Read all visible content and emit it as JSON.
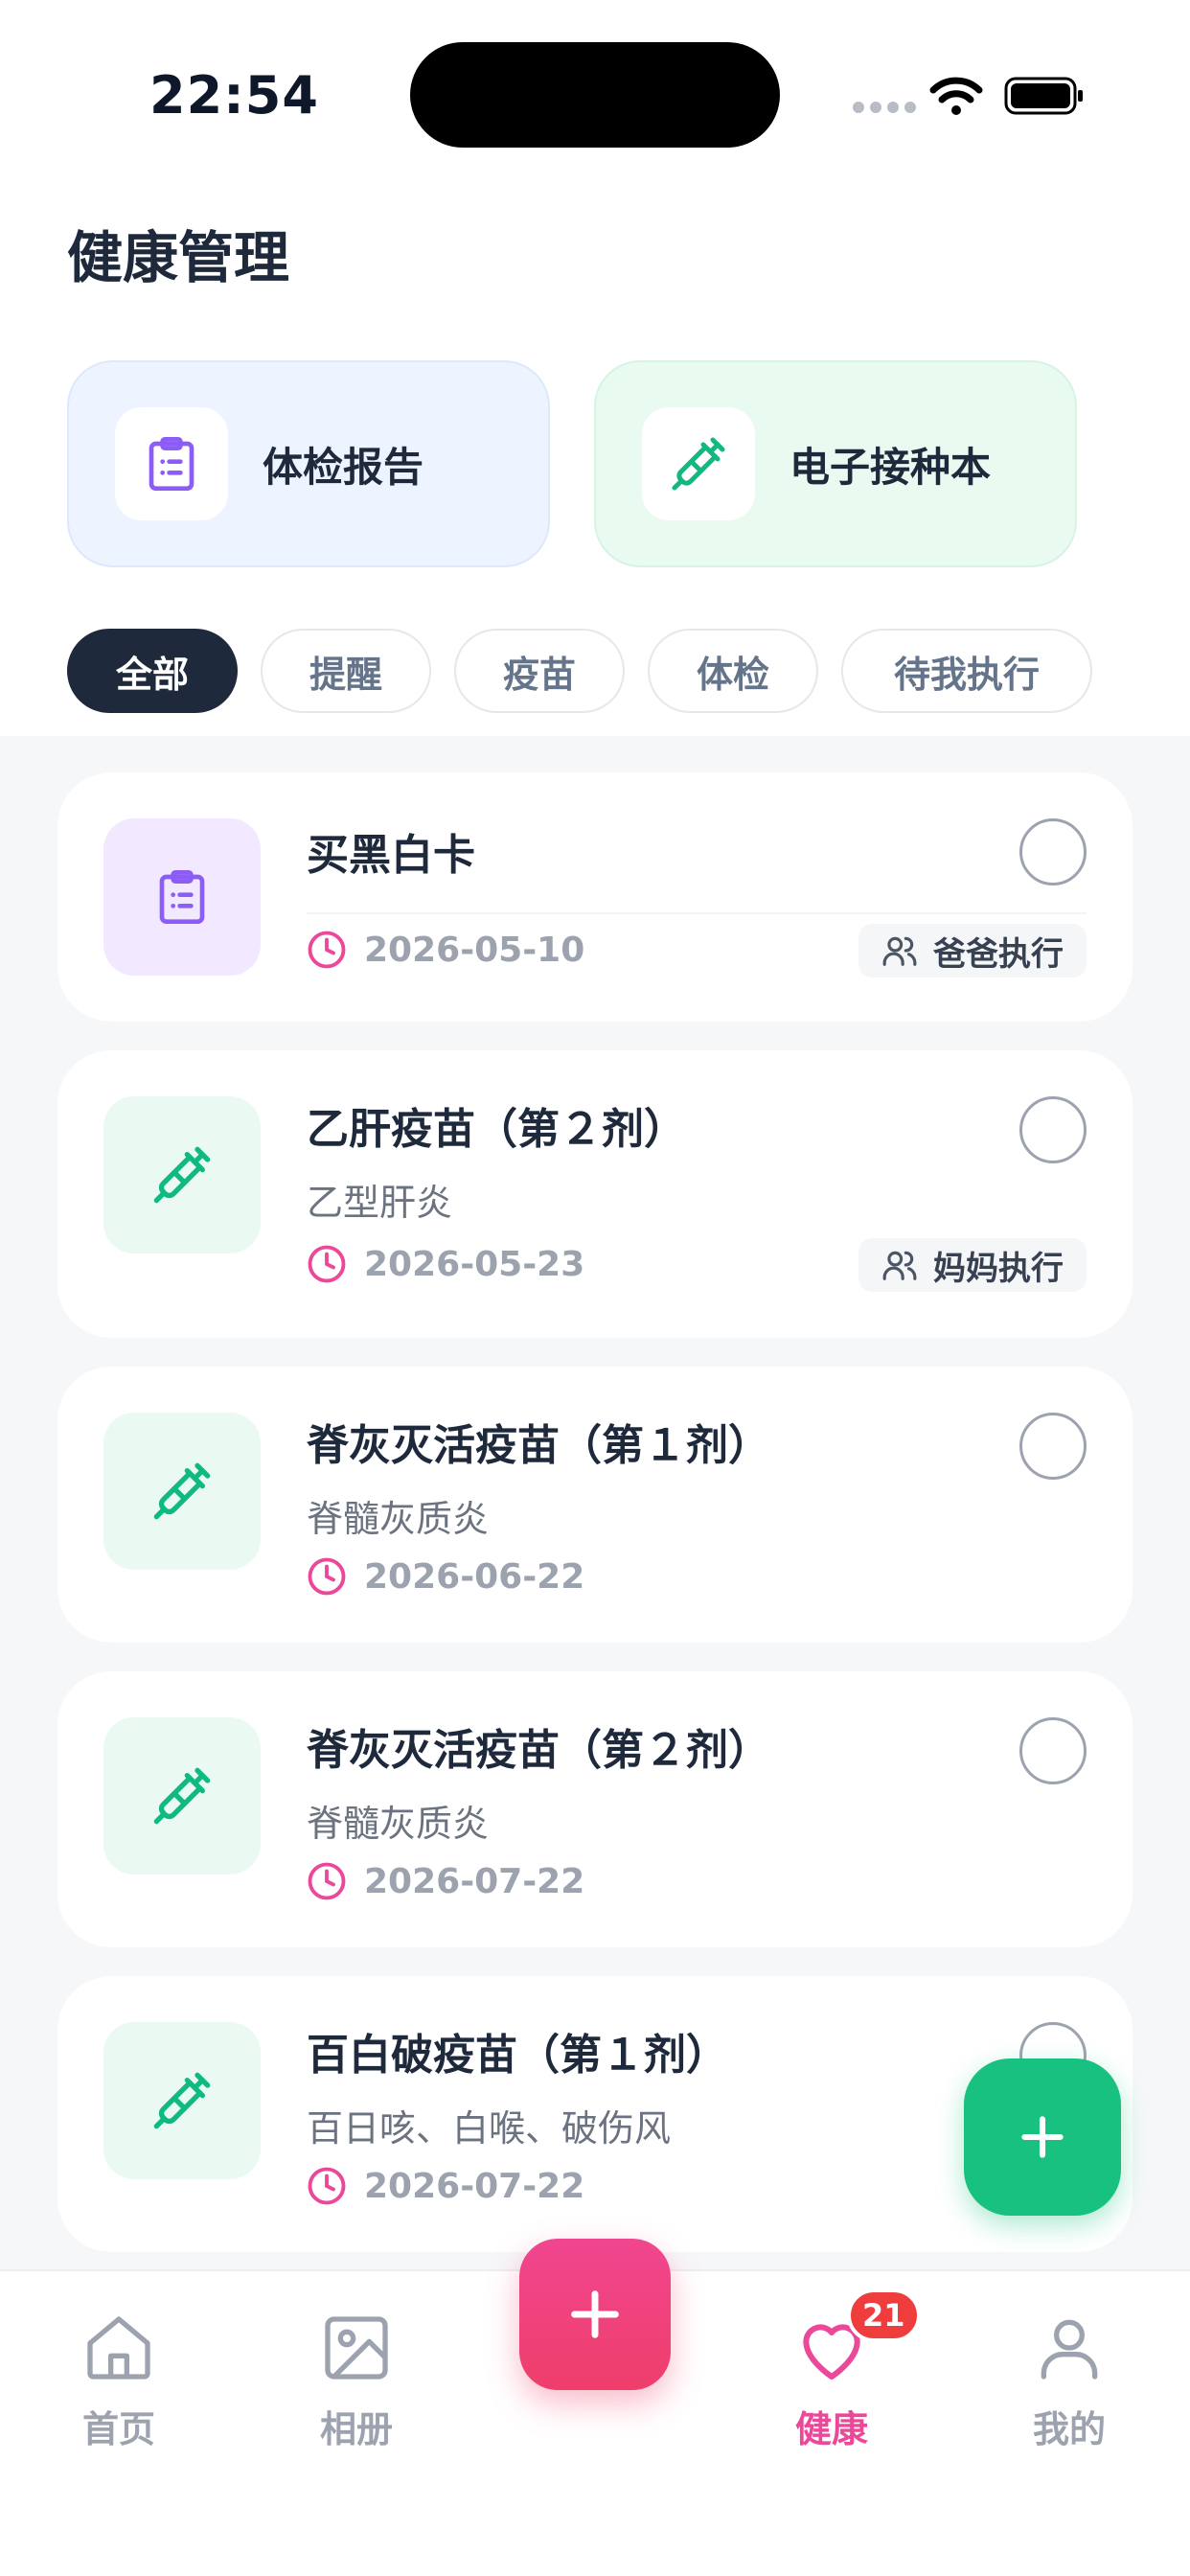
{
  "status_bar": {
    "time": "22:54"
  },
  "header": {
    "title": "健康管理"
  },
  "quick_cards": [
    {
      "label": "体检报告",
      "icon": "clipboard-icon",
      "color": "#8b5cf6"
    },
    {
      "label": "电子接种本",
      "icon": "syringe-icon",
      "color": "#10b981"
    }
  ],
  "filters": [
    {
      "label": "全部",
      "active": true
    },
    {
      "label": "提醒",
      "active": false
    },
    {
      "label": "疫苗",
      "active": false
    },
    {
      "label": "体检",
      "active": false
    },
    {
      "label": "待我执行",
      "active": false
    }
  ],
  "items": [
    {
      "title": "买黑白卡",
      "subtitle": "",
      "date": "2026-05-10",
      "executor": "爸爸执行",
      "icon": "clipboard-icon"
    },
    {
      "title": "乙肝疫苗（第２剂）",
      "subtitle": "乙型肝炎",
      "date": "2026-05-23",
      "executor": "妈妈执行",
      "icon": "syringe-icon"
    },
    {
      "title": "脊灰灭活疫苗（第１剂）",
      "subtitle": "脊髓灰质炎",
      "date": "2026-06-22",
      "executor": "",
      "icon": "syringe-icon"
    },
    {
      "title": "脊灰灭活疫苗（第２剂）",
      "subtitle": "脊髓灰质炎",
      "date": "2026-07-22",
      "executor": "",
      "icon": "syringe-icon"
    },
    {
      "title": "百白破疫苗（第１剂）",
      "subtitle": "百日咳、白喉、破伤风",
      "date": "2026-07-22",
      "executor": "",
      "icon": "syringe-icon"
    }
  ],
  "tabbar": {
    "tabs": [
      {
        "label": "首页",
        "icon": "home-icon"
      },
      {
        "label": "相册",
        "icon": "image-icon"
      },
      {
        "label": "健康",
        "icon": "heart-icon",
        "active": true
      },
      {
        "label": "我的",
        "icon": "user-icon"
      }
    ],
    "health_badge": "21"
  },
  "colors": {
    "accent_pink": "#ec4899",
    "accent_green": "#10b981",
    "dark": "#1e293b"
  }
}
